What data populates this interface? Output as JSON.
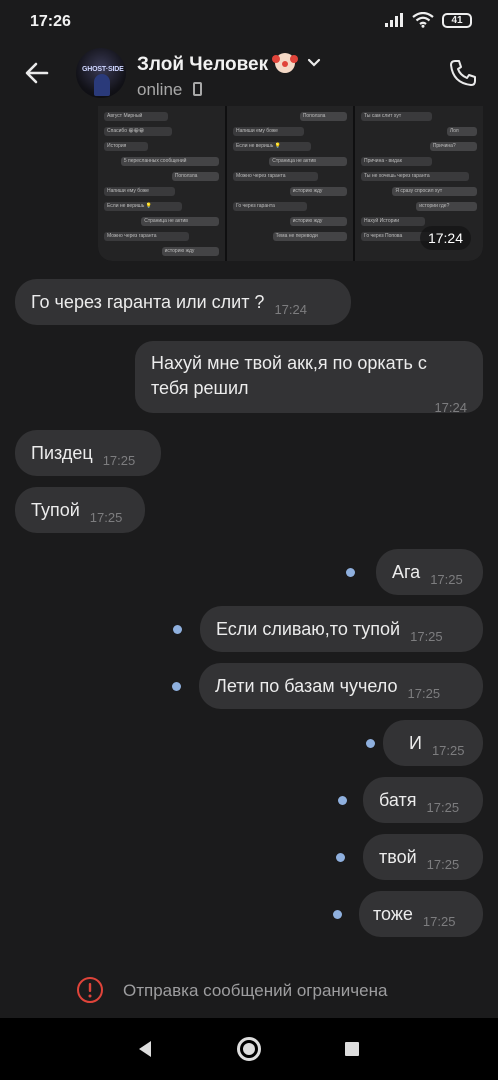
{
  "status_bar": {
    "time": "17:26",
    "battery": "41",
    "icons": [
      "signal-icon",
      "wifi-icon",
      "battery-icon"
    ]
  },
  "header": {
    "contact_name": "Злой Человек",
    "contact_emoji": "clown-face-icon",
    "status": "online",
    "icons": [
      "back-arrow-icon",
      "chevron-down-icon",
      "mobile-phone-icon",
      "call-icon"
    ]
  },
  "image_message": {
    "time": "17:24",
    "screenshots": [
      {
        "lines": [
          {
            "text": "Август Мирный",
            "me": false
          },
          {
            "text": "Спасибо 😁😁😁",
            "me": false
          },
          {
            "text": "История",
            "me": false
          },
          {
            "text": "5 пересланных сообщений",
            "me": true
          },
          {
            "text": "Поползла",
            "me": true
          },
          {
            "text": "Напиши ему боже",
            "me": false
          },
          {
            "text": "Если не веришь 💡",
            "me": false
          },
          {
            "text": "Страница не актив",
            "me": true
          },
          {
            "text": "Можно через гаранта",
            "me": false
          },
          {
            "text": "историю жду",
            "me": true
          }
        ]
      },
      {
        "lines": [
          {
            "text": "Поползла",
            "me": true
          },
          {
            "text": "Напиши ему боже",
            "me": false
          },
          {
            "text": "Если не веришь 💡",
            "me": false
          },
          {
            "text": "Страница не актив",
            "me": true
          },
          {
            "text": "Можно через гаранта",
            "me": false
          },
          {
            "text": "историю жду",
            "me": true
          },
          {
            "text": "Го через гаранта",
            "me": false
          },
          {
            "text": "историю жду",
            "me": true
          },
          {
            "text": "Тема не переводи",
            "me": true
          }
        ]
      },
      {
        "lines": [
          {
            "text": "Ты сам слит хут",
            "me": false
          },
          {
            "text": "Лол",
            "me": true
          },
          {
            "text": "Причина?",
            "me": true
          },
          {
            "text": "Причина - видак",
            "me": false
          },
          {
            "text": "Ты не хочешь через гаранта",
            "me": false
          },
          {
            "text": "Я сразу спросил хут",
            "me": true
          },
          {
            "text": "истории где?",
            "me": true
          },
          {
            "text": "Нахуй Истории",
            "me": false
          },
          {
            "text": "Го через Попова",
            "me": false
          }
        ]
      }
    ]
  },
  "messages": [
    {
      "text": "Го через гаранта или слит ?",
      "time": "17:24",
      "direction": "in"
    },
    {
      "text": "Нахуй мне твой акк,я по оркать с тебя решил",
      "time": "17:24",
      "direction": "out"
    },
    {
      "text": "Пиздец",
      "time": "17:25",
      "direction": "in"
    },
    {
      "text": "Тупой",
      "time": "17:25",
      "direction": "in"
    },
    {
      "text": "Ага",
      "time": "17:25",
      "direction": "out"
    },
    {
      "text": "Если сливаю,то тупой",
      "time": "17:25",
      "direction": "out"
    },
    {
      "text": "Лети по базам чучело",
      "time": "17:25",
      "direction": "out"
    },
    {
      "text": "И",
      "time": "17:25",
      "direction": "out"
    },
    {
      "text": "батя",
      "time": "17:25",
      "direction": "out"
    },
    {
      "text": "твой",
      "time": "17:25",
      "direction": "out"
    },
    {
      "text": "тоже",
      "time": "17:25",
      "direction": "out"
    }
  ],
  "restriction": {
    "text": "Отправка сообщений ограничена",
    "icon": "warning-circle-icon",
    "color": "#e0443a"
  },
  "colors": {
    "background": "#1b1b1c",
    "bubble": "#333335",
    "unread_dot": "#8fb0de"
  },
  "nav": {
    "icons": [
      "nav-back-icon",
      "nav-home-icon",
      "nav-recents-icon"
    ]
  }
}
